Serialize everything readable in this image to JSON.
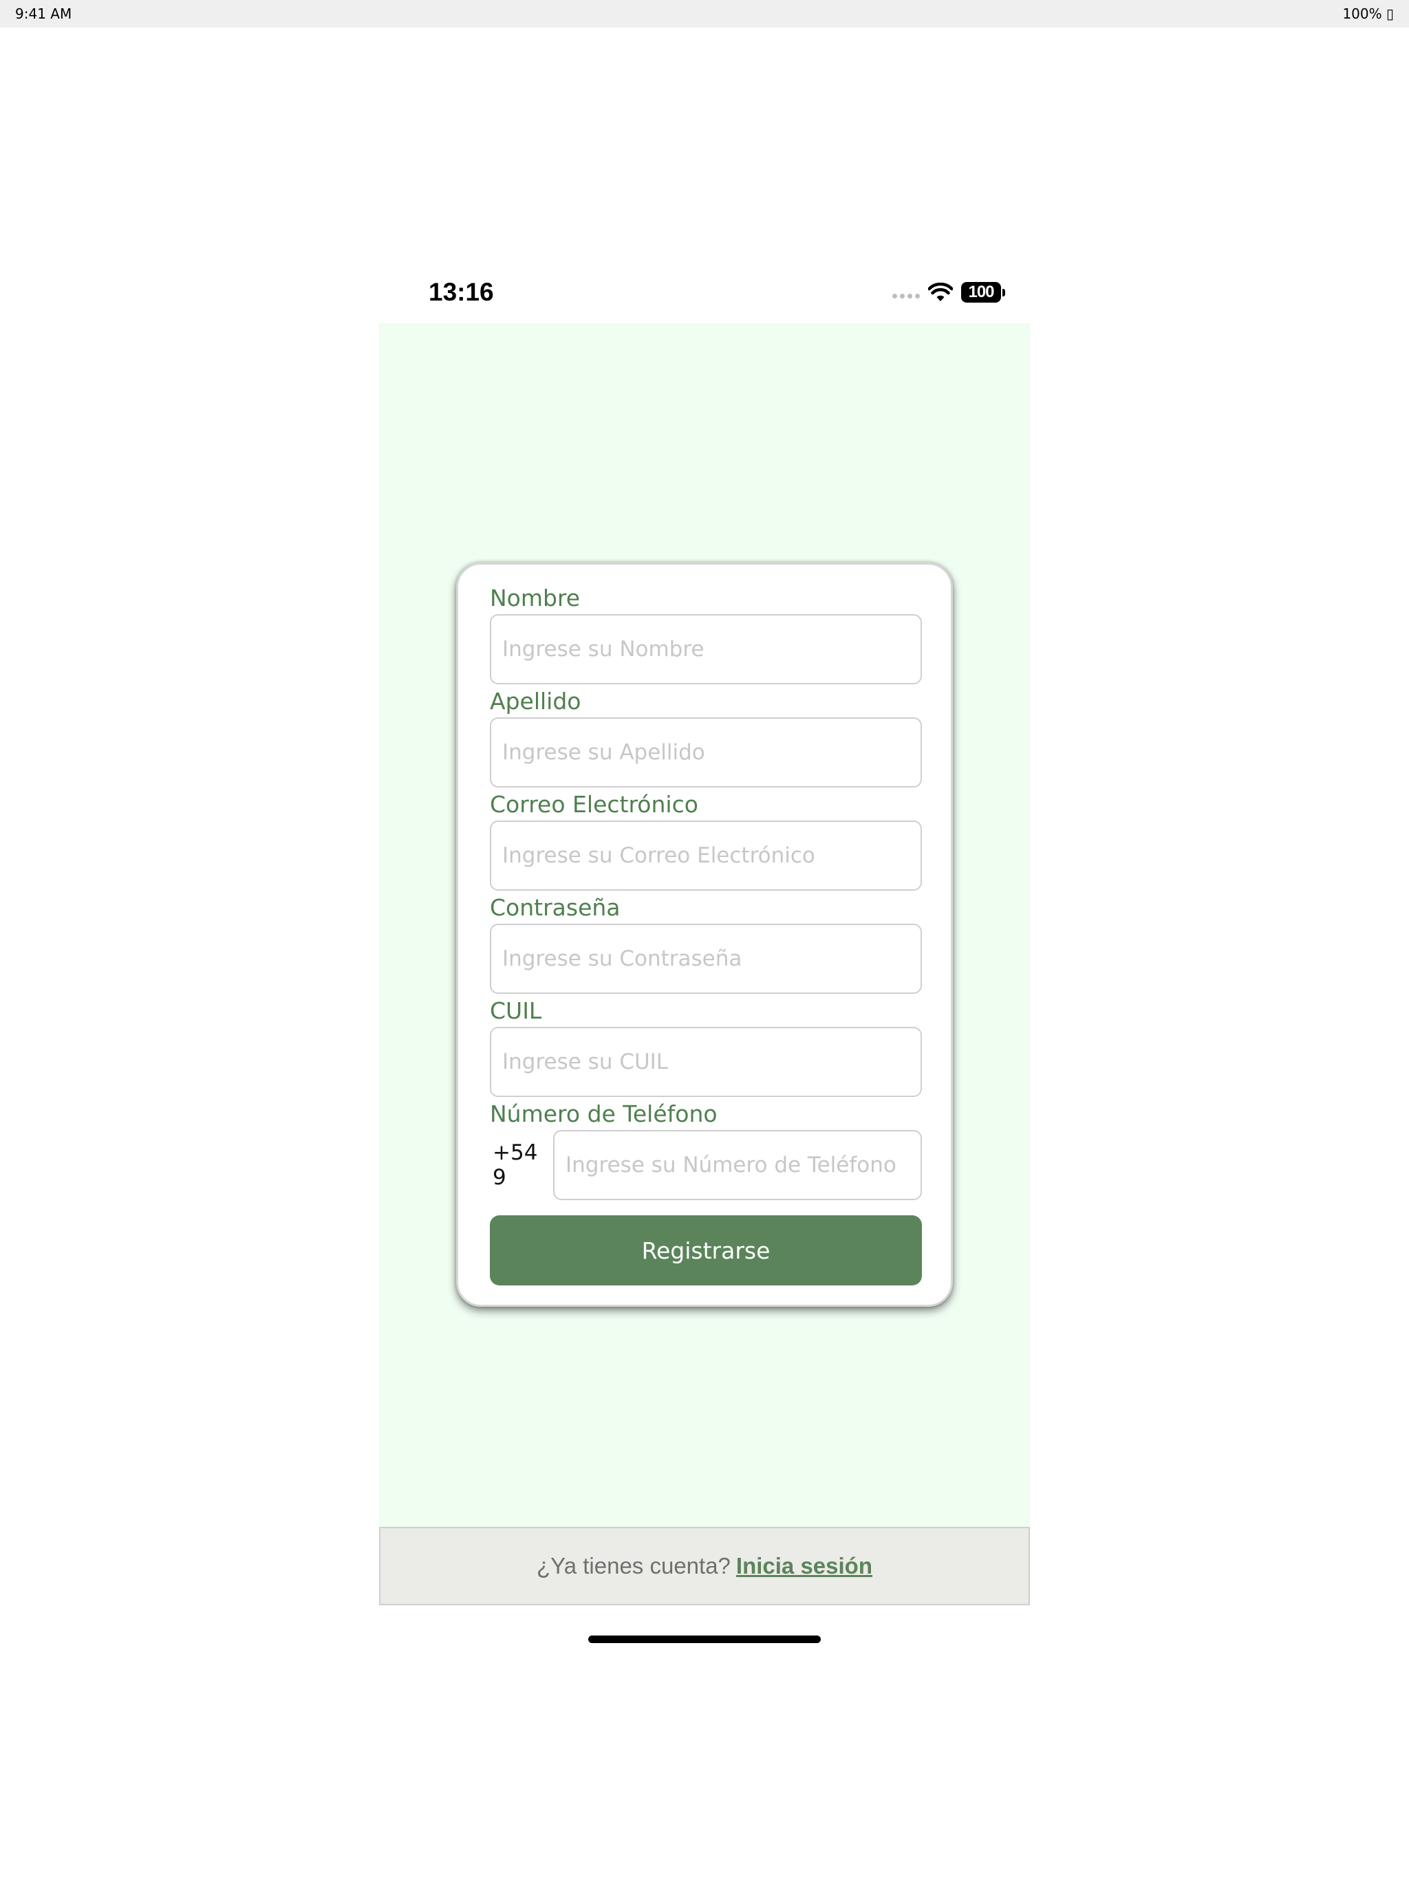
{
  "device_status": {
    "time": "9:41 AM",
    "battery": "100% ▯"
  },
  "phone_status": {
    "time": "13:16",
    "battery": "100"
  },
  "form": {
    "fields": [
      {
        "label": "Nombre",
        "placeholder": "Ingrese su Nombre",
        "value": ""
      },
      {
        "label": "Apellido",
        "placeholder": "Ingrese su Apellido",
        "value": ""
      },
      {
        "label": "Correo Electrónico",
        "placeholder": "Ingrese su Correo Electrónico",
        "value": ""
      },
      {
        "label": "Contraseña",
        "placeholder": "Ingrese su Contraseña",
        "value": ""
      },
      {
        "label": "CUIL",
        "placeholder": "Ingrese su CUIL",
        "value": ""
      }
    ],
    "phone": {
      "label": "Número de Teléfono",
      "prefix": "+54 9",
      "placeholder": "Ingrese su Número de Teléfono",
      "value": ""
    },
    "submit_label": "Registrarse"
  },
  "footer": {
    "prompt": "¿Ya tienes cuenta?",
    "link": "Inicia sesión"
  },
  "colors": {
    "accent": "#5b845b",
    "label": "#4f7f4f",
    "screen_background": "#f0fdf1",
    "footer_background": "#ebebe7"
  }
}
